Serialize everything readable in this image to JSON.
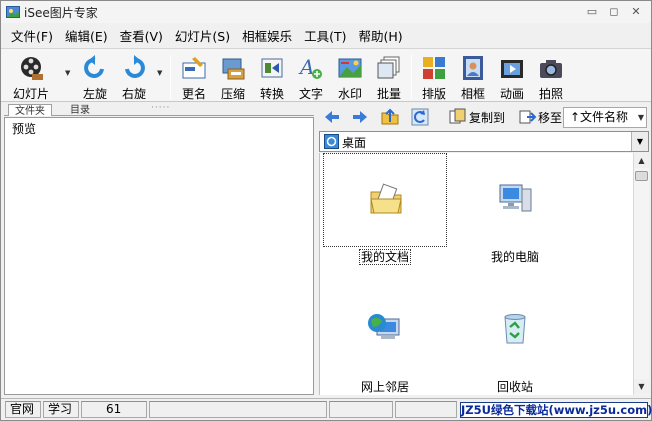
{
  "window": {
    "title": "iSee图片专家"
  },
  "title_controls": [
    {
      "name": "minimize-button",
      "glyph": "▭"
    },
    {
      "name": "maximize-button",
      "glyph": "◻"
    },
    {
      "name": "close-button",
      "glyph": "✕"
    }
  ],
  "menu": [
    "文件(F)",
    "编辑(E)",
    "查看(V)",
    "幻灯片(S)",
    "相框娱乐",
    "工具(T)",
    "帮助(H)"
  ],
  "toolbar": {
    "slideshow": "幻灯片",
    "rotate_left": "左旋",
    "rotate_right": "右旋",
    "rename": "更名",
    "compress": "压缩",
    "convert": "转换",
    "text": "文字",
    "watermark": "水印",
    "batch": "批量",
    "layout": "排版",
    "frame": "相框",
    "animation": "动画",
    "capture": "拍照"
  },
  "left_pane": {
    "tabs": [
      "文件夹",
      "目录"
    ],
    "preview_label": "预览"
  },
  "right_toolbar": {
    "copy_to": "复制到",
    "move_to": "移至",
    "sort_by": "↑文件名称"
  },
  "path": {
    "current": "桌面"
  },
  "files": [
    {
      "label": "我的文档",
      "icon": "my-documents-icon",
      "selected": true
    },
    {
      "label": "我的电脑",
      "icon": "my-computer-icon",
      "selected": false
    },
    {
      "label": "网上邻居",
      "icon": "network-places-icon",
      "selected": false
    },
    {
      "label": "回收站",
      "icon": "recycle-bin-icon",
      "selected": false
    }
  ],
  "status": {
    "site": "官网",
    "learn": "学习",
    "count": "61",
    "watermark": "JZ5U绿色下载站(www.jz5u.com)"
  },
  "colors": {
    "selection_border": "#333333",
    "watermark_text": "#0a2a9a"
  }
}
